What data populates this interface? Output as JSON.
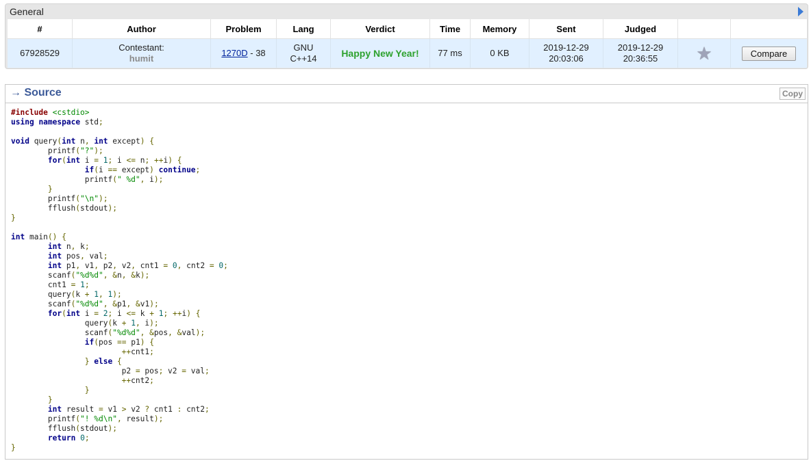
{
  "general": {
    "title": "General",
    "columns": [
      "#",
      "Author",
      "Problem",
      "Lang",
      "Verdict",
      "Time",
      "Memory",
      "Sent",
      "Judged",
      "",
      ""
    ],
    "row": {
      "id": "67928529",
      "author_role": "Contestant:",
      "author_handle": "humit",
      "problem_link": "1270D",
      "problem_suffix": " - 38",
      "lang_line1": "GNU",
      "lang_line2": "C++14",
      "verdict": "Happy New Year!",
      "time": "77 ms",
      "memory": "0 KB",
      "sent_date": "2019-12-29",
      "sent_time": "20:03:06",
      "judged_date": "2019-12-29",
      "judged_time": "20:36:55",
      "compare_label": "Compare"
    }
  },
  "source": {
    "title": "→ Source",
    "copy_label": "Copy",
    "code_lines": [
      "#include <cstdio>",
      "using namespace std;",
      "",
      "void query(int n, int except) {",
      "\tprintf(\"?\");",
      "\tfor(int i = 1; i <= n; ++i) {",
      "\t\tif(i == except) continue;",
      "\t\tprintf(\" %d\", i);",
      "\t}",
      "\tprintf(\"\\n\");",
      "\tfflush(stdout);",
      "}",
      "",
      "int main() {",
      "\tint n, k;",
      "\tint pos, val;",
      "\tint p1, v1, p2, v2, cnt1 = 0, cnt2 = 0;",
      "\tscanf(\"%d%d\", &n, &k);",
      "\tcnt1 = 1;",
      "\tquery(k + 1, 1);",
      "\tscanf(\"%d%d\", &p1, &v1);",
      "\tfor(int i = 2; i <= k + 1; ++i) {",
      "\t\tquery(k + 1, i);",
      "\t\tscanf(\"%d%d\", &pos, &val);",
      "\t\tif(pos == p1) {",
      "\t\t\t++cnt1;",
      "\t\t} else {",
      "\t\t\tp2 = pos; v2 = val;",
      "\t\t\t++cnt2;",
      "\t\t}",
      "\t}",
      "\tint result = v1 > v2 ? cnt1 : cnt2;",
      "\tprintf(\"! %d\\n\", result);",
      "\tfflush(stdout);",
      "\treturn 0;",
      "}"
    ]
  },
  "colors": {
    "row_bg": "#e1f0ff",
    "verdict": "#2ea22e",
    "source_title": "#3b5998",
    "keyword": "#000088",
    "string": "#008800"
  }
}
